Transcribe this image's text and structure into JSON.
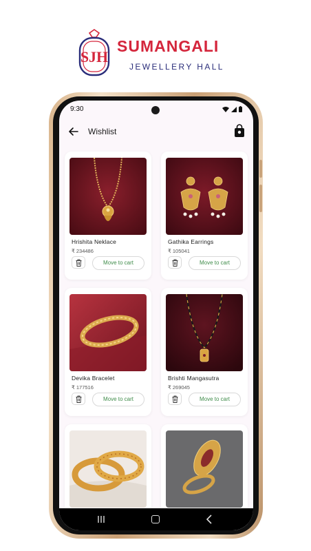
{
  "brand": {
    "logo_text": "SJH",
    "name": "SUMANGALI",
    "subtitle": "JEWELLERY HALL",
    "colors": {
      "red": "#d4263c",
      "navy": "#2a2d7a"
    }
  },
  "status_bar": {
    "time": "9:30",
    "icons": [
      "wifi-icon",
      "signal-icon",
      "battery-icon"
    ]
  },
  "app_bar": {
    "title": "Wishlist",
    "back_icon": "arrow-left-icon",
    "cart_icon": "shopping-bag-icon"
  },
  "products": [
    {
      "name": "Hrishita Neklace",
      "price": "₹ 234486",
      "action": "Move to cart",
      "image": "gold-necklace"
    },
    {
      "name": "Gathika Earrings",
      "price": "₹ 105041",
      "action": "Move to cart",
      "image": "gold-earrings"
    },
    {
      "name": "Devika Bracelet",
      "price": "₹ 177516",
      "action": "Move to cart",
      "image": "gold-bracelet"
    },
    {
      "name": "Brishti Mangasutra",
      "price": "₹ 269045",
      "action": "Move to cart",
      "image": "mangalsutra"
    },
    {
      "name": "",
      "price": "",
      "action": "",
      "image": "gold-bangles"
    },
    {
      "name": "",
      "price": "",
      "action": "",
      "image": "gold-ring"
    }
  ],
  "nav_bar": {
    "icons": [
      "recent-apps-icon",
      "home-icon",
      "back-icon"
    ]
  },
  "colors": {
    "accent_green": "#3f8c4a",
    "screen_bg": "#fcf7fb"
  }
}
